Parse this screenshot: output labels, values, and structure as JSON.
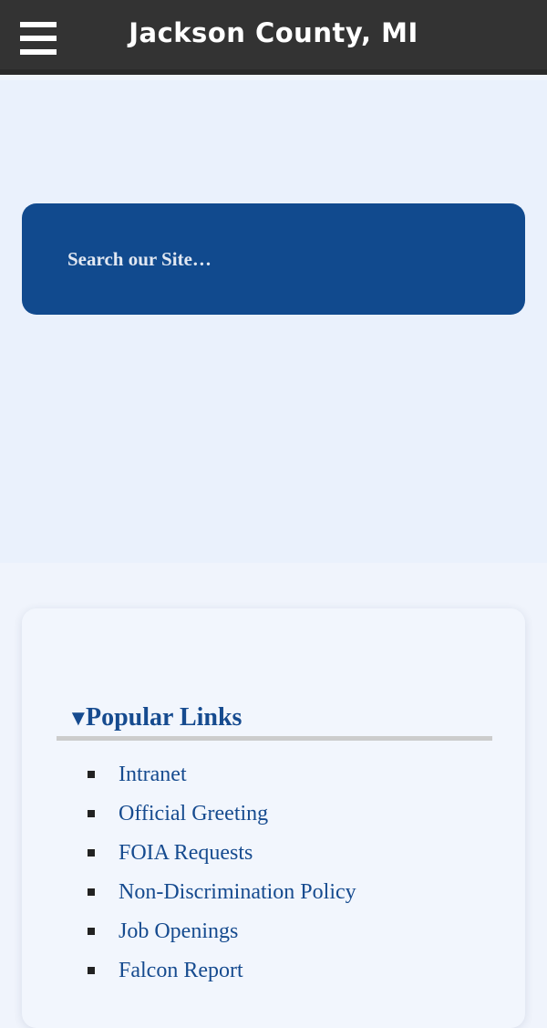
{
  "header": {
    "title": "Jackson County, MI",
    "menu_icon": "hamburger-menu-icon"
  },
  "search": {
    "placeholder": "Search our Site…"
  },
  "popular_links": {
    "heading": "Popular Links",
    "toggle_icon": "triangle-down-icon",
    "items": [
      {
        "label": "Intranet"
      },
      {
        "label": "Official Greeting"
      },
      {
        "label": "FOIA Requests"
      },
      {
        "label": "Non-Discrimination Policy"
      },
      {
        "label": "Job Openings"
      },
      {
        "label": "Falcon Report"
      }
    ]
  },
  "colors": {
    "topbar": "#333333",
    "search_box": "#114a8e",
    "link": "#164b8f",
    "hero_bg": "#eaf1fc"
  }
}
